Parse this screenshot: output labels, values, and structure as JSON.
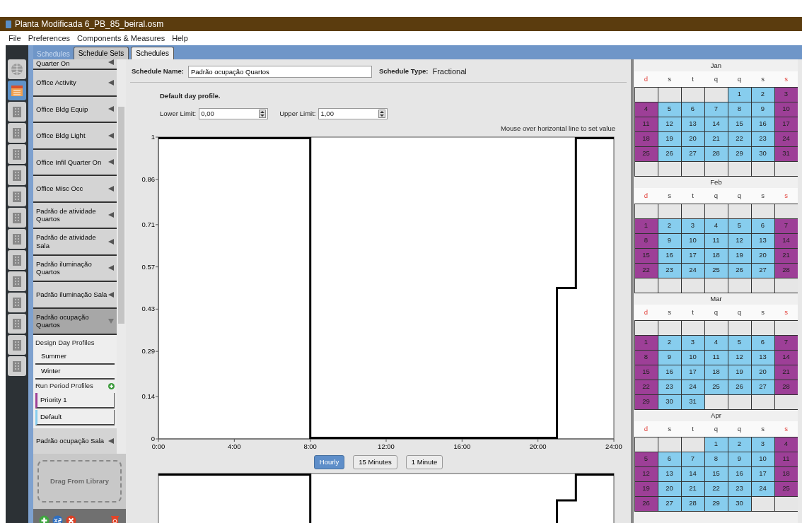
{
  "window": {
    "title": "Planta Modificada 6_PB_85_beiral.osm"
  },
  "menu": [
    "File",
    "Preferences",
    "Components & Measures",
    "Help"
  ],
  "nav_tabs": [
    {
      "selected": false
    },
    {
      "selected": true
    },
    {
      "selected": false
    },
    {
      "selected": false
    },
    {
      "selected": false
    },
    {
      "selected": false
    },
    {
      "selected": false
    },
    {
      "selected": false
    },
    {
      "selected": false
    },
    {
      "selected": false
    },
    {
      "selected": false
    },
    {
      "selected": false
    },
    {
      "selected": false
    },
    {
      "selected": false
    },
    {
      "selected": false
    }
  ],
  "tabs": {
    "caption": "Schedules",
    "items": [
      {
        "label": "Schedule Sets",
        "selected": false
      },
      {
        "label": "Schedules",
        "selected": true
      }
    ]
  },
  "schedule_list": {
    "items": [
      {
        "label": "Quarter On",
        "expanded": false
      },
      {
        "label": "Office Activity",
        "expanded": false
      },
      {
        "label": "Office Bldg Equip",
        "expanded": false
      },
      {
        "label": "Office Bldg Light",
        "expanded": false
      },
      {
        "label": "Office Infil Quarter On",
        "expanded": false
      },
      {
        "label": "Office Misc Occ",
        "expanded": false
      },
      {
        "label": "Padrão de atividade Quartos",
        "expanded": false
      },
      {
        "label": "Padrão de atividade Sala",
        "expanded": false
      },
      {
        "label": "Padrão iluminação Quartos",
        "expanded": false
      },
      {
        "label": "Padrão iluminação Sala",
        "expanded": false
      },
      {
        "label": "Padrão ocupação Quartos",
        "expanded": true,
        "design_day_profiles": {
          "label": "Design Day Profiles",
          "items": [
            "Summer",
            "Winter"
          ]
        },
        "run_period_profiles": {
          "label": "Run Period Profiles",
          "items": [
            {
              "label": "Priority 1",
              "color": "#9d3f97"
            },
            {
              "label": "Default",
              "color": "#87cdee"
            }
          ]
        }
      },
      {
        "label": "Padrão ocupação Sala",
        "expanded": false
      }
    ]
  },
  "library_drop": {
    "label": "Drag From Library"
  },
  "editor": {
    "name_label": "Schedule Name:",
    "name_value": "Padrão ocupação Quartos",
    "type_label": "Schedule Type:",
    "type_value": "Fractional",
    "profile_title": "Default day profile.",
    "lower_label": "Lower Limit:",
    "lower_value": "0,00",
    "upper_label": "Upper Limit:",
    "upper_value": "1,00",
    "hint": "Mouse over horizontal line to set value",
    "chart_data": {
      "type": "line",
      "x": [
        0,
        8,
        8,
        21,
        21,
        22,
        22,
        24
      ],
      "series": [
        {
          "color": "#000000",
          "values": [
            1,
            1,
            0,
            0,
            0.5,
            0.5,
            1,
            1
          ]
        }
      ],
      "xlim": [
        0,
        24
      ],
      "ylim": [
        0,
        1
      ],
      "xticks": [
        {
          "value": 0,
          "label": "0:00"
        },
        {
          "value": 4,
          "label": "4:00"
        },
        {
          "value": 8,
          "label": "8:00"
        },
        {
          "value": 12,
          "label": "12:00"
        },
        {
          "value": 16,
          "label": "16:00"
        },
        {
          "value": 20,
          "label": "20:00"
        },
        {
          "value": 24,
          "label": "24:00"
        }
      ],
      "yticks": [
        0,
        0.14,
        0.29,
        0.43,
        0.57,
        0.71,
        0.86,
        1
      ]
    },
    "resolutions": [
      {
        "label": "Hourly",
        "selected": true
      },
      {
        "label": "15 Minutes",
        "selected": false
      },
      {
        "label": "1 Minute",
        "selected": false
      }
    ]
  },
  "calendar": {
    "months": [
      {
        "name": "Jan",
        "weekdays": [
          {
            "label": "d",
            "weekend": true
          },
          {
            "label": "s",
            "weekend": false
          },
          {
            "label": "t",
            "weekend": false
          },
          {
            "label": "q",
            "weekend": false
          },
          {
            "label": "q",
            "weekend": false
          },
          {
            "label": "s",
            "weekend": false
          },
          {
            "label": "s",
            "weekend": true
          }
        ],
        "weeks": [
          [
            {
              "kind": "blank"
            },
            {
              "kind": "blank"
            },
            {
              "kind": "blank"
            },
            {
              "kind": "blank"
            },
            {
              "kind": "day",
              "day": "1",
              "color": "#87cdee"
            },
            {
              "kind": "day",
              "day": "2",
              "color": "#87cdee"
            },
            {
              "kind": "day",
              "day": "3",
              "color": "#9d3f97"
            }
          ],
          [
            {
              "kind": "day",
              "day": "4",
              "color": "#9d3f97"
            },
            {
              "kind": "day",
              "day": "5",
              "color": "#87cdee"
            },
            {
              "kind": "day",
              "day": "6",
              "color": "#87cdee"
            },
            {
              "kind": "day",
              "day": "7",
              "color": "#87cdee"
            },
            {
              "kind": "day",
              "day": "8",
              "color": "#87cdee"
            },
            {
              "kind": "day",
              "day": "9",
              "color": "#87cdee"
            },
            {
              "kind": "day",
              "day": "10",
              "color": "#9d3f97"
            }
          ],
          [
            {
              "kind": "day",
              "day": "11",
              "color": "#9d3f97"
            },
            {
              "kind": "day",
              "day": "12",
              "color": "#87cdee"
            },
            {
              "kind": "day",
              "day": "13",
              "color": "#87cdee"
            },
            {
              "kind": "day",
              "day": "14",
              "color": "#87cdee"
            },
            {
              "kind": "day",
              "day": "15",
              "color": "#87cdee"
            },
            {
              "kind": "day",
              "day": "16",
              "color": "#87cdee"
            },
            {
              "kind": "day",
              "day": "17",
              "color": "#9d3f97"
            }
          ],
          [
            {
              "kind": "day",
              "day": "18",
              "color": "#9d3f97"
            },
            {
              "kind": "day",
              "day": "19",
              "color": "#87cdee"
            },
            {
              "kind": "day",
              "day": "20",
              "color": "#87cdee"
            },
            {
              "kind": "day",
              "day": "21",
              "color": "#87cdee"
            },
            {
              "kind": "day",
              "day": "22",
              "color": "#87cdee"
            },
            {
              "kind": "day",
              "day": "23",
              "color": "#87cdee"
            },
            {
              "kind": "day",
              "day": "24",
              "color": "#9d3f97"
            }
          ],
          [
            {
              "kind": "day",
              "day": "25",
              "color": "#9d3f97"
            },
            {
              "kind": "day",
              "day": "26",
              "color": "#87cdee"
            },
            {
              "kind": "day",
              "day": "27",
              "color": "#87cdee"
            },
            {
              "kind": "day",
              "day": "28",
              "color": "#87cdee"
            },
            {
              "kind": "day",
              "day": "29",
              "color": "#87cdee"
            },
            {
              "kind": "day",
              "day": "30",
              "color": "#87cdee"
            },
            {
              "kind": "day",
              "day": "31",
              "color": "#9d3f97"
            }
          ],
          [
            {
              "kind": "blank"
            },
            {
              "kind": "blank"
            },
            {
              "kind": "blank"
            },
            {
              "kind": "blank"
            },
            {
              "kind": "blank"
            },
            {
              "kind": "blank"
            },
            {
              "kind": "blank"
            }
          ]
        ]
      },
      {
        "name": "Feb",
        "weekdays": [
          {
            "label": "d",
            "weekend": true
          },
          {
            "label": "s",
            "weekend": false
          },
          {
            "label": "t",
            "weekend": false
          },
          {
            "label": "q",
            "weekend": false
          },
          {
            "label": "q",
            "weekend": false
          },
          {
            "label": "s",
            "weekend": false
          },
          {
            "label": "s",
            "weekend": true
          }
        ],
        "weeks": [
          [
            {
              "kind": "blank"
            },
            {
              "kind": "blank"
            },
            {
              "kind": "blank"
            },
            {
              "kind": "blank"
            },
            {
              "kind": "blank"
            },
            {
              "kind": "blank"
            },
            {
              "kind": "blank"
            }
          ],
          [
            {
              "kind": "day",
              "day": "1",
              "color": "#9d3f97"
            },
            {
              "kind": "day",
              "day": "2",
              "color": "#87cdee"
            },
            {
              "kind": "day",
              "day": "3",
              "color": "#87cdee"
            },
            {
              "kind": "day",
              "day": "4",
              "color": "#87cdee"
            },
            {
              "kind": "day",
              "day": "5",
              "color": "#87cdee"
            },
            {
              "kind": "day",
              "day": "6",
              "color": "#87cdee"
            },
            {
              "kind": "day",
              "day": "7",
              "color": "#9d3f97"
            }
          ],
          [
            {
              "kind": "day",
              "day": "8",
              "color": "#9d3f97"
            },
            {
              "kind": "day",
              "day": "9",
              "color": "#87cdee"
            },
            {
              "kind": "day",
              "day": "10",
              "color": "#87cdee"
            },
            {
              "kind": "day",
              "day": "11",
              "color": "#87cdee"
            },
            {
              "kind": "day",
              "day": "12",
              "color": "#87cdee"
            },
            {
              "kind": "day",
              "day": "13",
              "color": "#87cdee"
            },
            {
              "kind": "day",
              "day": "14",
              "color": "#9d3f97"
            }
          ],
          [
            {
              "kind": "day",
              "day": "15",
              "color": "#9d3f97"
            },
            {
              "kind": "day",
              "day": "16",
              "color": "#87cdee"
            },
            {
              "kind": "day",
              "day": "17",
              "color": "#87cdee"
            },
            {
              "kind": "day",
              "day": "18",
              "color": "#87cdee"
            },
            {
              "kind": "day",
              "day": "19",
              "color": "#87cdee"
            },
            {
              "kind": "day",
              "day": "20",
              "color": "#87cdee"
            },
            {
              "kind": "day",
              "day": "21",
              "color": "#9d3f97"
            }
          ],
          [
            {
              "kind": "day",
              "day": "22",
              "color": "#9d3f97"
            },
            {
              "kind": "day",
              "day": "23",
              "color": "#87cdee"
            },
            {
              "kind": "day",
              "day": "24",
              "color": "#87cdee"
            },
            {
              "kind": "day",
              "day": "25",
              "color": "#87cdee"
            },
            {
              "kind": "day",
              "day": "26",
              "color": "#87cdee"
            },
            {
              "kind": "day",
              "day": "27",
              "color": "#87cdee"
            },
            {
              "kind": "day",
              "day": "28",
              "color": "#9d3f97"
            }
          ],
          [
            {
              "kind": "blank"
            },
            {
              "kind": "blank"
            },
            {
              "kind": "blank"
            },
            {
              "kind": "blank"
            },
            {
              "kind": "blank"
            },
            {
              "kind": "blank"
            },
            {
              "kind": "blank"
            }
          ]
        ]
      },
      {
        "name": "Mar",
        "weekdays": [
          {
            "label": "d",
            "weekend": true
          },
          {
            "label": "s",
            "weekend": false
          },
          {
            "label": "t",
            "weekend": false
          },
          {
            "label": "q",
            "weekend": false
          },
          {
            "label": "q",
            "weekend": false
          },
          {
            "label": "s",
            "weekend": false
          },
          {
            "label": "s",
            "weekend": true
          }
        ],
        "weeks": [
          [
            {
              "kind": "blank"
            },
            {
              "kind": "blank"
            },
            {
              "kind": "blank"
            },
            {
              "kind": "blank"
            },
            {
              "kind": "blank"
            },
            {
              "kind": "blank"
            },
            {
              "kind": "blank"
            }
          ],
          [
            {
              "kind": "day",
              "day": "1",
              "color": "#9d3f97"
            },
            {
              "kind": "day",
              "day": "2",
              "color": "#87cdee"
            },
            {
              "kind": "day",
              "day": "3",
              "color": "#87cdee"
            },
            {
              "kind": "day",
              "day": "4",
              "color": "#87cdee"
            },
            {
              "kind": "day",
              "day": "5",
              "color": "#87cdee"
            },
            {
              "kind": "day",
              "day": "6",
              "color": "#87cdee"
            },
            {
              "kind": "day",
              "day": "7",
              "color": "#9d3f97"
            }
          ],
          [
            {
              "kind": "day",
              "day": "8",
              "color": "#9d3f97"
            },
            {
              "kind": "day",
              "day": "9",
              "color": "#87cdee"
            },
            {
              "kind": "day",
              "day": "10",
              "color": "#87cdee"
            },
            {
              "kind": "day",
              "day": "11",
              "color": "#87cdee"
            },
            {
              "kind": "day",
              "day": "12",
              "color": "#87cdee"
            },
            {
              "kind": "day",
              "day": "13",
              "color": "#87cdee"
            },
            {
              "kind": "day",
              "day": "14",
              "color": "#9d3f97"
            }
          ],
          [
            {
              "kind": "day",
              "day": "15",
              "color": "#9d3f97"
            },
            {
              "kind": "day",
              "day": "16",
              "color": "#87cdee"
            },
            {
              "kind": "day",
              "day": "17",
              "color": "#87cdee"
            },
            {
              "kind": "day",
              "day": "18",
              "color": "#87cdee"
            },
            {
              "kind": "day",
              "day": "19",
              "color": "#87cdee"
            },
            {
              "kind": "day",
              "day": "20",
              "color": "#87cdee"
            },
            {
              "kind": "day",
              "day": "21",
              "color": "#9d3f97"
            }
          ],
          [
            {
              "kind": "day",
              "day": "22",
              "color": "#9d3f97"
            },
            {
              "kind": "day",
              "day": "23",
              "color": "#87cdee"
            },
            {
              "kind": "day",
              "day": "24",
              "color": "#87cdee"
            },
            {
              "kind": "day",
              "day": "25",
              "color": "#87cdee"
            },
            {
              "kind": "day",
              "day": "26",
              "color": "#87cdee"
            },
            {
              "kind": "day",
              "day": "27",
              "color": "#87cdee"
            },
            {
              "kind": "day",
              "day": "28",
              "color": "#9d3f97"
            }
          ],
          [
            {
              "kind": "day",
              "day": "29",
              "color": "#9d3f97"
            },
            {
              "kind": "day",
              "day": "30",
              "color": "#87cdee"
            },
            {
              "kind": "day",
              "day": "31",
              "color": "#87cdee"
            },
            {
              "kind": "blank"
            },
            {
              "kind": "blank"
            },
            {
              "kind": "blank"
            },
            {
              "kind": "blank"
            }
          ]
        ]
      },
      {
        "name": "Apr",
        "weekdays": [
          {
            "label": "d",
            "weekend": true
          },
          {
            "label": "s",
            "weekend": false
          },
          {
            "label": "t",
            "weekend": false
          },
          {
            "label": "q",
            "weekend": false
          },
          {
            "label": "q",
            "weekend": false
          },
          {
            "label": "s",
            "weekend": false
          },
          {
            "label": "s",
            "weekend": true
          }
        ],
        "weeks": [
          [
            {
              "kind": "blank"
            },
            {
              "kind": "blank"
            },
            {
              "kind": "blank"
            },
            {
              "kind": "day",
              "day": "1",
              "color": "#87cdee"
            },
            {
              "kind": "day",
              "day": "2",
              "color": "#87cdee"
            },
            {
              "kind": "day",
              "day": "3",
              "color": "#87cdee"
            },
            {
              "kind": "day",
              "day": "4",
              "color": "#9d3f97"
            }
          ],
          [
            {
              "kind": "day",
              "day": "5",
              "color": "#9d3f97"
            },
            {
              "kind": "day",
              "day": "6",
              "color": "#87cdee"
            },
            {
              "kind": "day",
              "day": "7",
              "color": "#87cdee"
            },
            {
              "kind": "day",
              "day": "8",
              "color": "#87cdee"
            },
            {
              "kind": "day",
              "day": "9",
              "color": "#87cdee"
            },
            {
              "kind": "day",
              "day": "10",
              "color": "#87cdee"
            },
            {
              "kind": "day",
              "day": "11",
              "color": "#9d3f97"
            }
          ],
          [
            {
              "kind": "day",
              "day": "12",
              "color": "#9d3f97"
            },
            {
              "kind": "day",
              "day": "13",
              "color": "#87cdee"
            },
            {
              "kind": "day",
              "day": "14",
              "color": "#87cdee"
            },
            {
              "kind": "day",
              "day": "15",
              "color": "#87cdee"
            },
            {
              "kind": "day",
              "day": "16",
              "color": "#87cdee"
            },
            {
              "kind": "day",
              "day": "17",
              "color": "#87cdee"
            },
            {
              "kind": "day",
              "day": "18",
              "color": "#9d3f97"
            }
          ],
          [
            {
              "kind": "day",
              "day": "19",
              "color": "#9d3f97"
            },
            {
              "kind": "day",
              "day": "20",
              "color": "#87cdee"
            },
            {
              "kind": "day",
              "day": "21",
              "color": "#87cdee"
            },
            {
              "kind": "day",
              "day": "22",
              "color": "#87cdee"
            },
            {
              "kind": "day",
              "day": "23",
              "color": "#87cdee"
            },
            {
              "kind": "day",
              "day": "24",
              "color": "#87cdee"
            },
            {
              "kind": "day",
              "day": "25",
              "color": "#9d3f97"
            }
          ],
          [
            {
              "kind": "day",
              "day": "26",
              "color": "#9d3f97"
            },
            {
              "kind": "day",
              "day": "27",
              "color": "#87cdee"
            },
            {
              "kind": "day",
              "day": "28",
              "color": "#87cdee"
            },
            {
              "kind": "day",
              "day": "29",
              "color": "#87cdee"
            },
            {
              "kind": "day",
              "day": "30",
              "color": "#87cdee"
            },
            {
              "kind": "blank"
            },
            {
              "kind": "blank"
            }
          ]
        ]
      }
    ]
  }
}
